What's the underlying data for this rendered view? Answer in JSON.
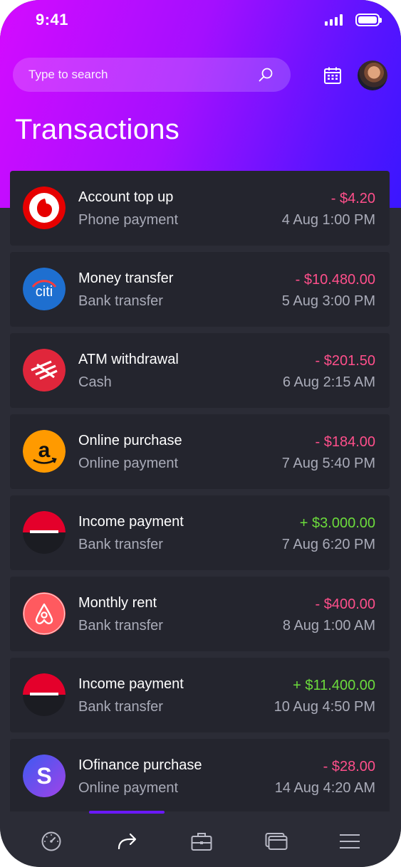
{
  "status_bar": {
    "time": "9:41"
  },
  "search": {
    "placeholder": "Type to search"
  },
  "page": {
    "title": "Transactions"
  },
  "transactions": [
    {
      "title": "Account top up",
      "subtitle": "Phone payment",
      "amount": "- $4.20",
      "date": "4 Aug 1:00 PM",
      "logo": "vodafone-logo"
    },
    {
      "title": "Money transfer",
      "subtitle": "Bank transfer",
      "amount": "- $10.480.00",
      "date": "5 Aug 3:00 PM",
      "logo": "citi-logo"
    },
    {
      "title": "ATM withdrawal",
      "subtitle": "Cash",
      "amount": "- $201.50",
      "date": "6 Aug 2:15 AM",
      "logo": "bank-of-america-logo"
    },
    {
      "title": "Online purchase",
      "subtitle": "Online payment",
      "amount": "- $184.00",
      "date": "7 Aug 5:40 PM",
      "logo": "amazon-logo"
    },
    {
      "title": "Income payment",
      "subtitle": "Bank transfer",
      "amount": "+ $3.000.00",
      "date": "7 Aug 6:20 PM",
      "logo": "bank-logo"
    },
    {
      "title": "Monthly rent",
      "subtitle": "Bank transfer",
      "amount": "- $400.00",
      "date": "8 Aug 1:00 AM",
      "logo": "airbnb-logo"
    },
    {
      "title": "Income payment",
      "subtitle": "Bank transfer",
      "amount": "+ $11.400.00",
      "date": "10 Aug 4:50 PM",
      "logo": "bank-logo"
    },
    {
      "title": "IOfinance purchase",
      "subtitle": "Online payment",
      "amount": "- $28.00",
      "date": "14 Aug 4:20 AM",
      "logo": "stripe-logo"
    }
  ],
  "tab_bar": {
    "items": [
      "dashboard-icon",
      "transfer-icon",
      "wallet-briefcase-icon",
      "cards-icon",
      "menu-icon"
    ],
    "active_index": 1
  },
  "colors": {
    "negative": "#ff4f8b",
    "positive": "#6cdc3c",
    "accent": "#6a18ff",
    "gradient_start": "#d40bff",
    "gradient_end": "#3a16ff"
  }
}
